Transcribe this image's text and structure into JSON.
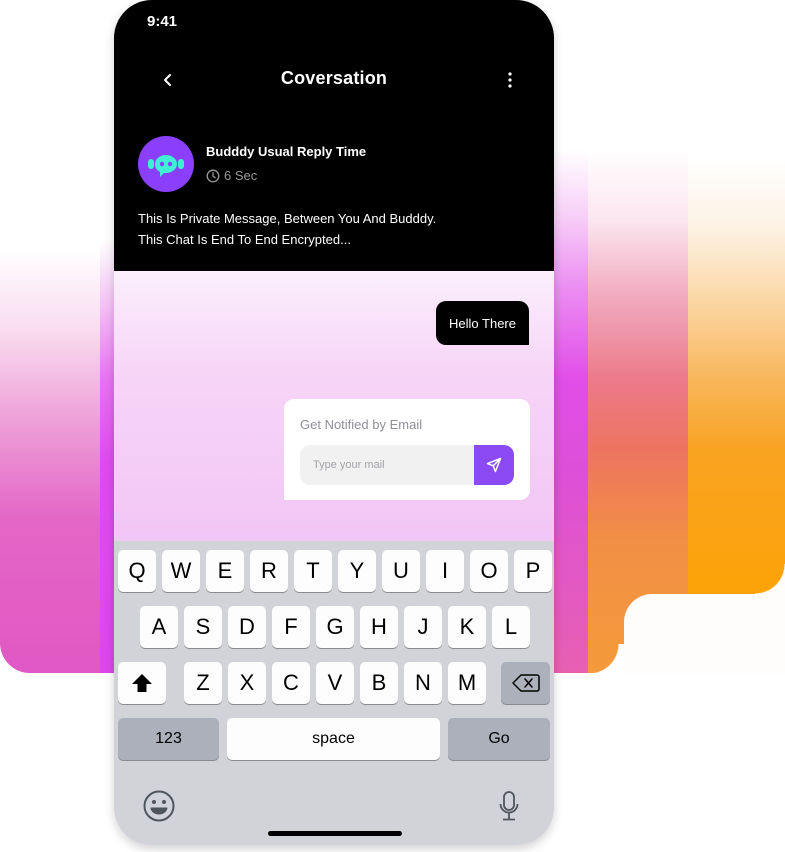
{
  "status_bar": {
    "time": "9:41"
  },
  "nav": {
    "title": "Coversation",
    "back_icon": "chevron-left-icon",
    "more_icon": "more-vertical-icon"
  },
  "reply_info": {
    "avatar_icon": "bot-chat-icon",
    "title": "Budddy Usual Reply Time",
    "clock_icon": "clock-icon",
    "time": "6 Sec"
  },
  "private_notice": {
    "line1": "This Is Private Message, Between You And Budddy.",
    "line2": "This Chat Is End To End Encrypted..."
  },
  "messages": [
    {
      "sender": "user",
      "text": "Hello There"
    }
  ],
  "email_card": {
    "label": "Get Notified by Email",
    "input_value": "",
    "input_placeholder": "Type your mail",
    "send_icon": "send-icon"
  },
  "keyboard": {
    "row1": [
      "Q",
      "W",
      "E",
      "R",
      "T",
      "Y",
      "U",
      "I",
      "O",
      "P"
    ],
    "row2": [
      "A",
      "S",
      "D",
      "F",
      "G",
      "H",
      "J",
      "K",
      "L"
    ],
    "row3": [
      "Z",
      "X",
      "C",
      "V",
      "B",
      "N",
      "M"
    ],
    "shift_icon": "shift-icon",
    "backspace_icon": "backspace-icon",
    "numbers_label": "123",
    "space_label": "space",
    "go_label": "Go",
    "emoji_icon": "emoji-icon",
    "mic_icon": "microphone-icon"
  },
  "colors": {
    "accent": "#8b4af3",
    "avatar_bg": "#8a3ffc",
    "avatar_fg": "#3ef0d4",
    "header_bg": "#000000",
    "keyboard_bg": "#d1d3d9"
  }
}
